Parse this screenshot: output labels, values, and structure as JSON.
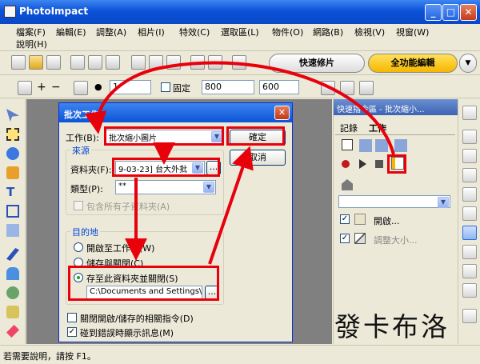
{
  "window": {
    "title": "PhotoImpact",
    "minimize": "_",
    "maximize": "□",
    "close": "✕"
  },
  "menu": [
    "檔案(F)",
    "編輯(E)",
    "調整(A)",
    "相片(I)",
    "特效(C)",
    "選取區(L)",
    "物件(O)",
    "網路(B)",
    "檢視(V)",
    "視窗(W)",
    "說明(H)"
  ],
  "modes": {
    "quick": "快速修片",
    "full": "全功能編輯",
    "dropdown": "▼"
  },
  "toolbar2": {
    "size_value": "1",
    "fixed_label": "固定",
    "width_value": "800",
    "height_value": "600"
  },
  "dialog": {
    "title": "批次工作",
    "close": "✕",
    "job_label": "工作(B):",
    "job_value": "批次縮小圖片",
    "ok": "確定",
    "cancel": "取消",
    "source_group": "來源",
    "folder_label": "資料夾(F):",
    "folder_value": "9-03-23] 台大外批",
    "browse": "...",
    "type_label": "類型(P):",
    "type_value": "**",
    "include_sub": "包含所有子資料夾(A)",
    "dest_group": "目的地",
    "opt_open": "開啟至工作區(W)",
    "opt_save_close": "儲存與關閉(C)",
    "opt_save_folder": "存至此資料夾並關閉(S)",
    "dest_path": "C:\\Documents and Settings\\",
    "close_opened": "關閉開啟/儲存的相關指令(D)",
    "show_errors": "碰到錯誤時顯示訊息(M)"
  },
  "panel": {
    "title": "快速指令區 - 批次縮小...",
    "tab_record": "記錄",
    "tab_job": "工作",
    "items": [
      "開啟...",
      "調整大小..."
    ]
  },
  "status": {
    "text": "若需要說明，請按 F1。"
  },
  "watermark": "發卡布洛",
  "colors": {
    "annotation_red": "#e8000b",
    "titlebar_blue": "#0a52d8",
    "full_mode_orange": "#f6b700"
  }
}
